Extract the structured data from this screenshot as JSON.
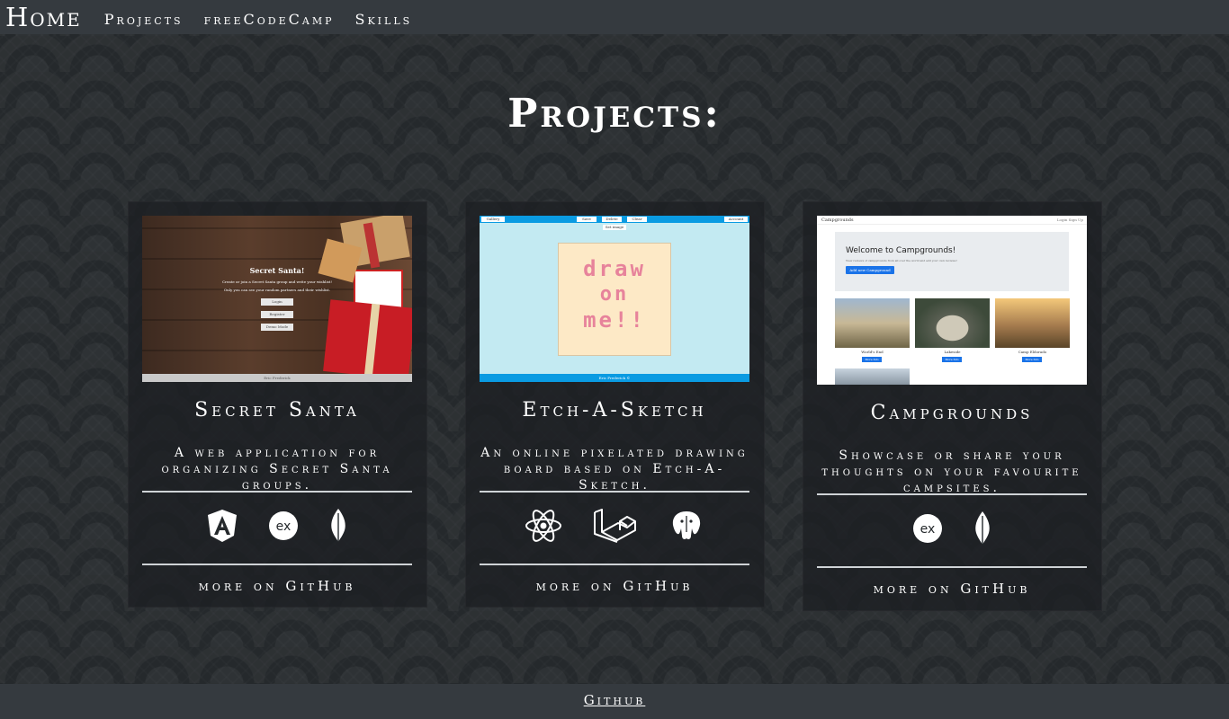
{
  "nav": {
    "brand": "Home",
    "items": [
      "Projects",
      "freeCodeCamp",
      "Skills"
    ]
  },
  "page": {
    "title": "Projects:"
  },
  "cards": [
    {
      "title": "Secret Santa",
      "description": "A web application for organizing Secret Santa groups.",
      "link": "more on GitHub",
      "thumb": {
        "heading": "Secret Santa!",
        "line1": "Create or join a Secret Santa group and write your wishlist!",
        "line2": "Only you can see your random partners and their wishlist.",
        "buttons": [
          "Login",
          "Register",
          "Demo Mode"
        ],
        "footer": "Eric Frederick"
      },
      "icons": [
        "angular-icon",
        "express-icon",
        "mongodb-leaf-icon"
      ]
    },
    {
      "title": "Etch-A-Sketch",
      "description": "An online pixelated drawing board based on Etch-A-Sketch.",
      "link": "more on GitHub",
      "thumb": {
        "menu_left": "Gallery",
        "menu_center": [
          "Save",
          "Delete",
          "Clear"
        ],
        "menu_right": "Account",
        "sub": "Set image",
        "drawn_line1": "draw",
        "drawn_line2": "on",
        "drawn_line3": "me!!",
        "footer": "Eric Frederick ©"
      },
      "icons": [
        "react-icon",
        "laravel-icon",
        "postgresql-icon"
      ]
    },
    {
      "title": "Campgrounds",
      "description": "Showcase or share your thoughts on your favourite campsites.",
      "link": "more on GitHub",
      "thumb": {
        "brand": "Campgrounds",
        "auth": "Login  Sign Up",
        "welcome": "Welcome to Campgrounds!",
        "welcome_sub": "View reviews of campgrounds from all over the world and add your own reviews!",
        "add_button": "Add new Campground",
        "items": [
          "World's End",
          "Lakeside",
          "Camp Eldorado"
        ],
        "more": "More Info"
      },
      "icons": [
        "express-icon",
        "mongodb-leaf-icon"
      ]
    }
  ],
  "footer": {
    "link": "Github",
    "cut": ""
  }
}
